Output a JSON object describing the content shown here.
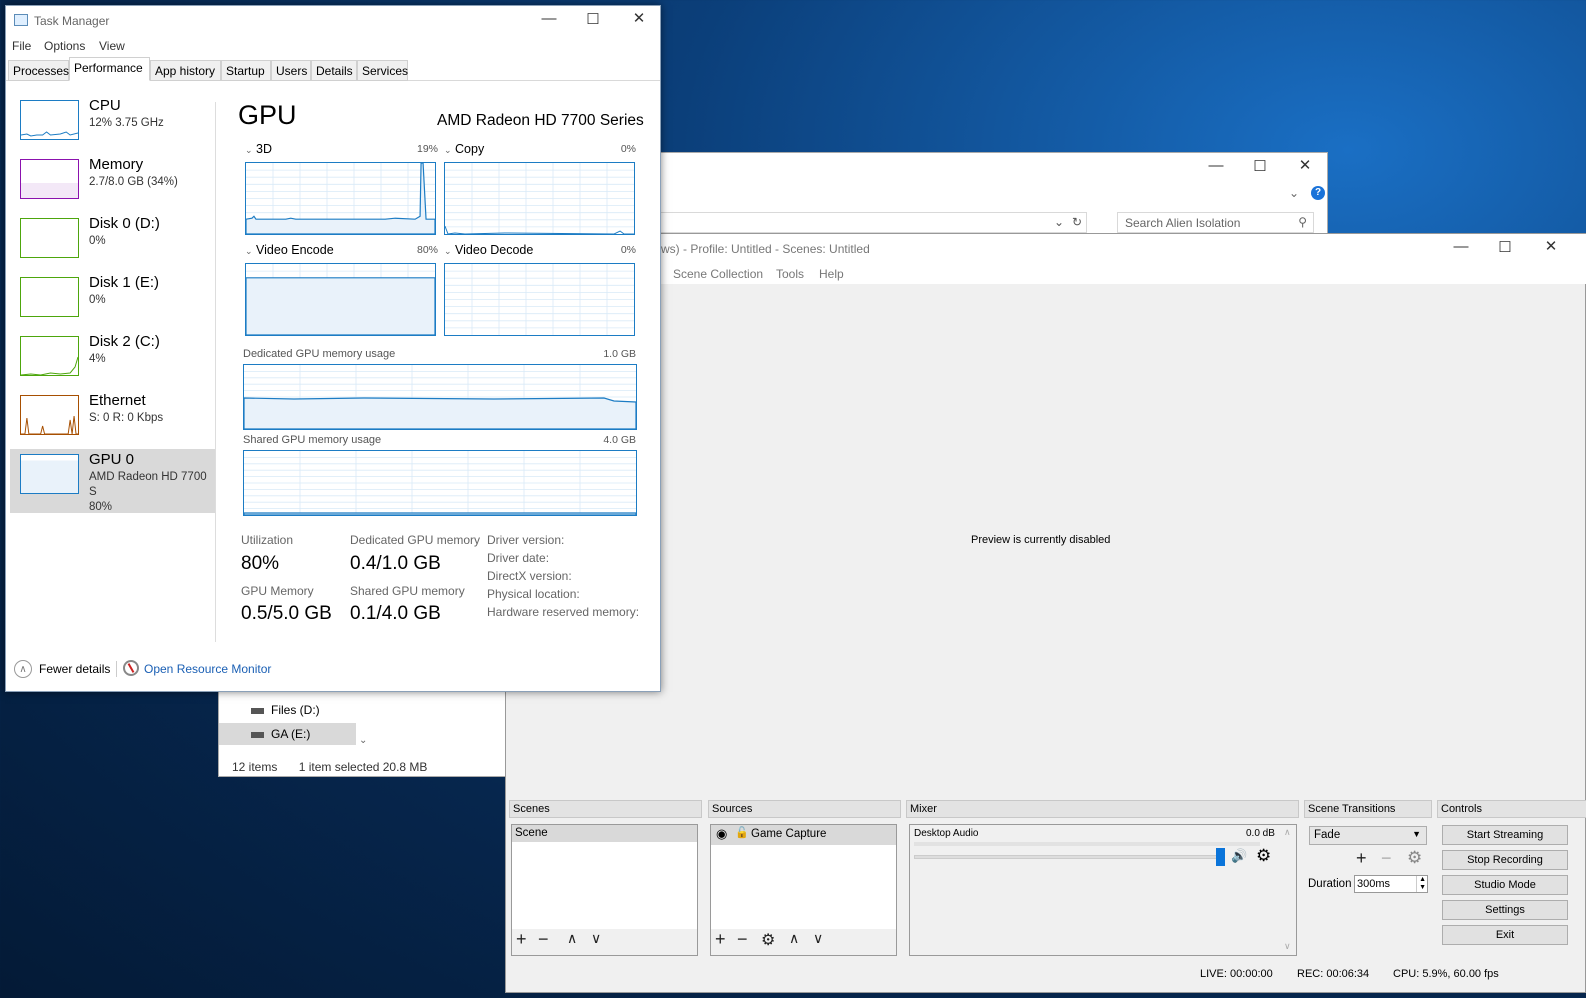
{
  "explorer": {
    "search_placeholder": "Search Alien Isolation",
    "nav": [
      "Files (D:)",
      "GA (E:)"
    ],
    "status_items": "12 items",
    "status_selected": "1 item selected  20.8 MB"
  },
  "obs": {
    "title": "ws) - Profile: Untitled - Scenes: Untitled",
    "menu": [
      "Scene Collection",
      "Tools",
      "Help"
    ],
    "preview_text": "Preview is currently disabled",
    "docks": {
      "scenes": "Scenes",
      "sources": "Sources",
      "mixer": "Mixer",
      "transitions": "Scene Transitions",
      "controls": "Controls"
    },
    "scene_item": "Scene",
    "source_item": "Game Capture",
    "mixer": {
      "channel": "Desktop Audio",
      "level": "0.0 dB",
      "volume": 1.0
    },
    "transition": "Fade",
    "duration_label": "Duration",
    "duration_value": "300ms",
    "controls": [
      "Start Streaming",
      "Stop Recording",
      "Studio Mode",
      "Settings",
      "Exit"
    ],
    "status": {
      "live": "LIVE: 00:00:00",
      "rec": "REC: 00:06:34",
      "cpu": "CPU: 5.9%, 60.00 fps"
    }
  },
  "taskmgr": {
    "title": "Task Manager",
    "menu": [
      "File",
      "Options",
      "View"
    ],
    "tabs": [
      "Processes",
      "Performance",
      "App history",
      "Startup",
      "Users",
      "Details",
      "Services"
    ],
    "active_tab": "Performance",
    "sidebar": [
      {
        "name": "CPU",
        "detail": "12% 3.75 GHz",
        "color": "#1c7cc4"
      },
      {
        "name": "Memory",
        "detail": "2.7/8.0 GB (34%)",
        "color": "#8b12ae"
      },
      {
        "name": "Disk 0 (D:)",
        "detail": "0%",
        "color": "#4da60c"
      },
      {
        "name": "Disk 1 (E:)",
        "detail": "0%",
        "color": "#4da60c"
      },
      {
        "name": "Disk 2 (C:)",
        "detail": "4%",
        "color": "#4da60c"
      },
      {
        "name": "Ethernet",
        "detail": "S: 0 R: 0 Kbps",
        "color": "#a74f01"
      },
      {
        "name": "GPU 0",
        "detail": "AMD Radeon HD 7700 S",
        "detail2": "80%",
        "color": "#1c7cc4"
      }
    ],
    "gpu": {
      "heading": "GPU",
      "model": "AMD Radeon HD 7700 Series",
      "engines": [
        {
          "name": "3D",
          "pct": "19%"
        },
        {
          "name": "Copy",
          "pct": "0%"
        },
        {
          "name": "Video Encode",
          "pct": "80%"
        },
        {
          "name": "Video Decode",
          "pct": "0%"
        }
      ],
      "dedicated_label": "Dedicated GPU memory usage",
      "dedicated_max": "1.0 GB",
      "shared_label": "Shared GPU memory usage",
      "shared_max": "4.0 GB",
      "stats": {
        "utilization_label": "Utilization",
        "utilization": "80%",
        "dedicated_mem_label": "Dedicated GPU memory",
        "dedicated_mem": "0.4/1.0 GB",
        "gpu_mem_label": "GPU Memory",
        "gpu_mem": "0.5/5.0 GB",
        "shared_mem_label": "Shared GPU memory",
        "shared_mem": "0.1/4.0 GB"
      },
      "driver": [
        "Driver version:",
        "Driver date:",
        "DirectX version:",
        "Physical location:",
        "Hardware reserved memory:"
      ]
    },
    "footer": {
      "fewer": "Fewer details",
      "monitor": "Open Resource Monitor"
    }
  }
}
